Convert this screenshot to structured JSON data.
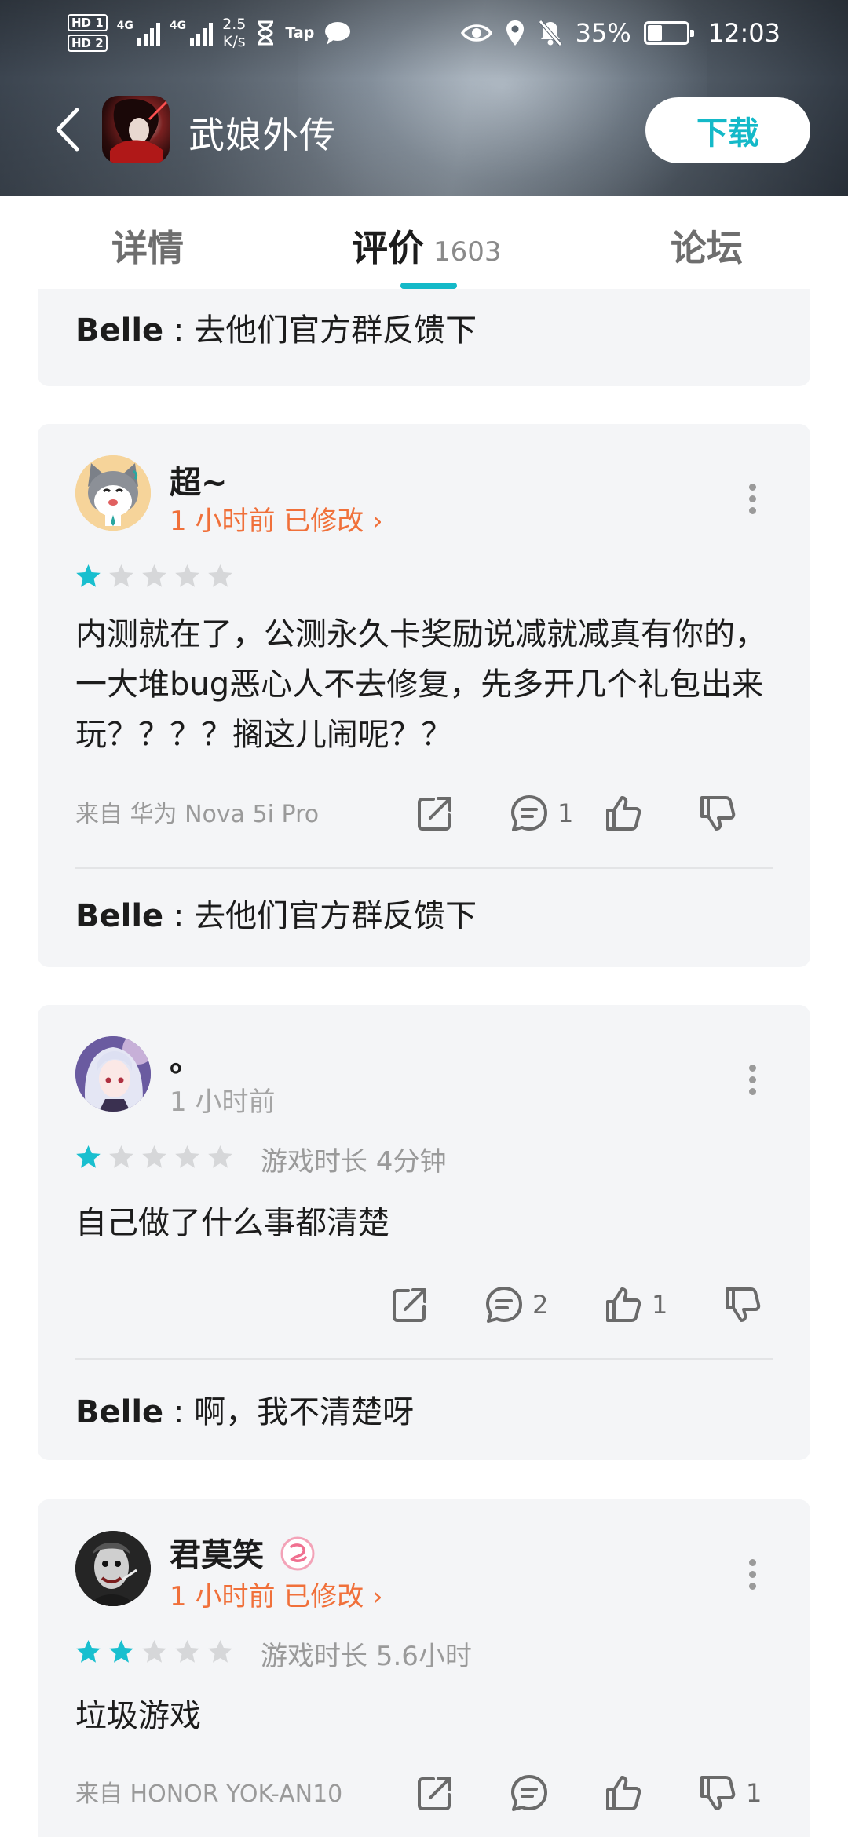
{
  "status_bar": {
    "hd1": "HD 1",
    "hd2": "HD 2",
    "sim1": "4G",
    "sim2": "4G",
    "speed_value": "2.5",
    "speed_unit": "K/s",
    "tap": "Tap",
    "battery": "35%",
    "time": "12:03"
  },
  "header": {
    "app_name": "武娘外传",
    "download_label": "下载"
  },
  "tabs": [
    {
      "label": "详情"
    },
    {
      "label": "评价",
      "count": "1603"
    },
    {
      "label": "论坛"
    }
  ],
  "reviews": [
    {
      "reply": {
        "author": "Belle",
        "sep": " : ",
        "text": "去他们官方群反馈下"
      }
    },
    {
      "user": "超~",
      "time": "1 小时前 已修改 ›",
      "rating": 1,
      "text": "内测就在了，公测永久卡奖励说减就减真有你的，一大堆bug恶心人不去修复，先多开几个礼包出来玩？？？？搁这儿闹呢？？",
      "device": "来自 华为 Nova 5i Pro",
      "comments": "1",
      "likes": "",
      "dislikes": "",
      "reply": {
        "author": "Belle",
        "sep": " : ",
        "text": "去他们官方群反馈下"
      }
    },
    {
      "user": "。",
      "time": "1 小时前",
      "rating": 1,
      "playtime": "游戏时长 4分钟",
      "text": "自己做了什么事都清楚",
      "comments": "2",
      "likes": "1",
      "dislikes": "",
      "reply": {
        "author": "Belle",
        "sep": " : ",
        "text": "啊，我不清楚呀"
      }
    },
    {
      "user": "君莫笑",
      "time": "1 小时前 已修改 ›",
      "rating": 2,
      "playtime": "游戏时长 5.6小时",
      "text": "垃圾游戏",
      "device": "来自 HONOR YOK-AN10",
      "comments": "",
      "likes": "",
      "dislikes": "1"
    }
  ],
  "colors": {
    "accent": "#14b9c8",
    "edited_orange": "#f0703a",
    "star_on": "#19bfcf",
    "star_off": "#d6d7d9"
  }
}
